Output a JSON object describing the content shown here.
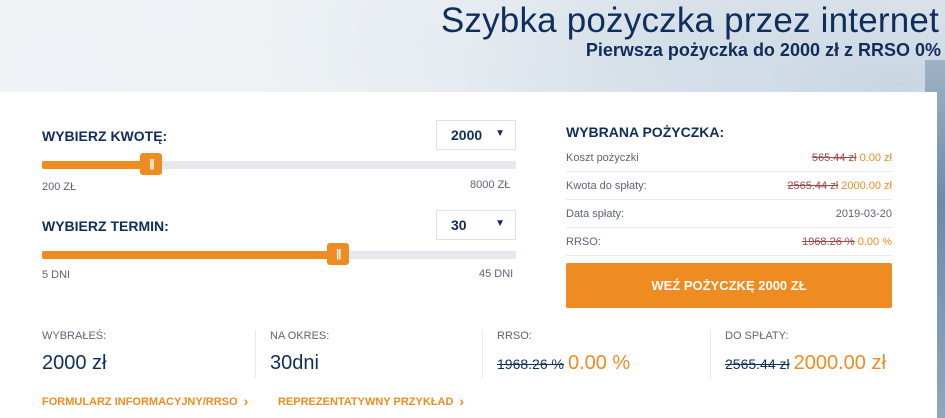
{
  "header": {
    "title": "Szybka pożyczka przez internet",
    "subtitle": "Pierwsza pożyczka do 2000 zł z RRSO 0%"
  },
  "amount": {
    "label": "WYBIERZ KWOTĘ:",
    "selected": "2000",
    "min_label": "200 ZŁ",
    "max_label": "8000 ZŁ",
    "slider_fraction": 0.231
  },
  "term": {
    "label": "WYBIERZ TERMIN:",
    "selected": "30",
    "min_label": "5 DNI",
    "max_label": "45 DNI",
    "slider_fraction": 0.625
  },
  "summary": {
    "title": "WYBRANA POŻYCZKA:",
    "rows": [
      {
        "label": "Koszt pożyczki",
        "old": "565.44 zł",
        "new": "0.00 zł"
      },
      {
        "label": "Kwota do spłaty:",
        "old": "2565.44 zł",
        "new": "2000.00 zł"
      },
      {
        "label": "Data spłaty:",
        "old": "",
        "value": "2019-03-20"
      },
      {
        "label": "RRSO:",
        "old": "1968.26 %",
        "new": "0.00 %"
      }
    ],
    "cta": "WEŹ POŻYCZKĘ 2000 ZŁ"
  },
  "stats": {
    "chosen_label": "WYBRAŁEŚ:",
    "chosen_value": "2000 zł",
    "period_label": "NA OKRES:",
    "period_value": "30dni",
    "rrso_label": "RRSO:",
    "rrso_old": "1968.26 %",
    "rrso_new": "0.00 %",
    "repay_label": "DO SPŁATY:",
    "repay_old": "2565.44 zł",
    "repay_new": "2000.00 zł"
  },
  "links": {
    "form": "FORMULARZ INFORMACYJNY/RRSO",
    "example": "REPREZENTATYWNY PRZYKŁAD"
  },
  "colors": {
    "accent": "#ef8c21",
    "navy": "#0f2e5a",
    "strike": "#a04848"
  }
}
